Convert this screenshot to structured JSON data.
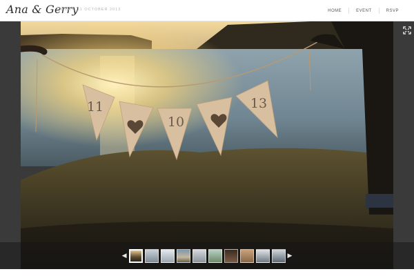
{
  "header": {
    "logo": "Ana & Gerry",
    "date": "FRIDAY, 11 OCTOBER 2013",
    "nav": [
      {
        "label": "HOME"
      },
      {
        "label": "EVENT"
      },
      {
        "label": "RSVP"
      }
    ]
  },
  "flags": [
    "11",
    "",
    "10",
    "",
    "13"
  ],
  "icons": {
    "fullscreen": "fullscreen-icon",
    "prev": "chevron-left-icon",
    "next": "chevron-right-icon",
    "heart": "heart-icon"
  },
  "gallery": {
    "thumbnail_count": 10,
    "active_index": 0
  },
  "colors": {
    "stage": "#3a3a3a",
    "header_bg": "#ffffff",
    "flag_fabric": "#d8bfa0"
  }
}
